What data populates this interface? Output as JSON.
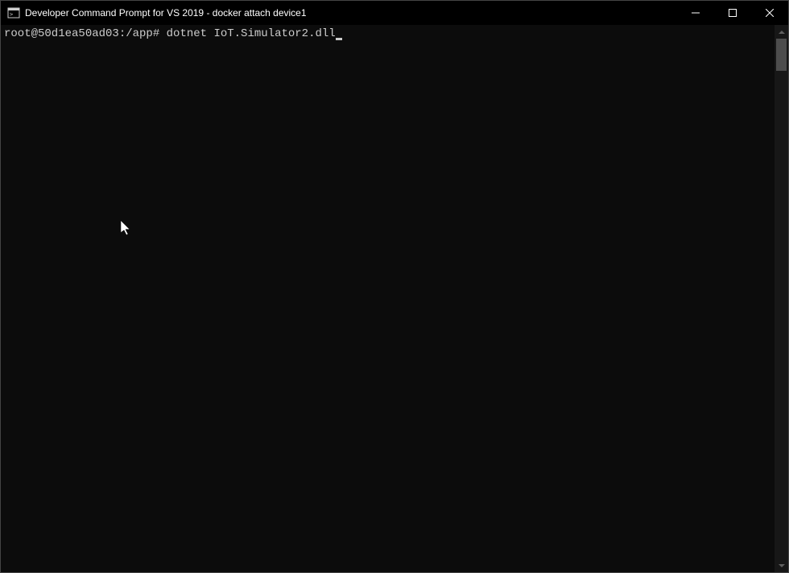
{
  "window": {
    "title": "Developer Command Prompt for VS 2019 - docker  attach device1"
  },
  "terminal": {
    "prompt": "root@50d1ea50ad03:/app#",
    "command": "dotnet IoT.Simulator2.dll"
  }
}
